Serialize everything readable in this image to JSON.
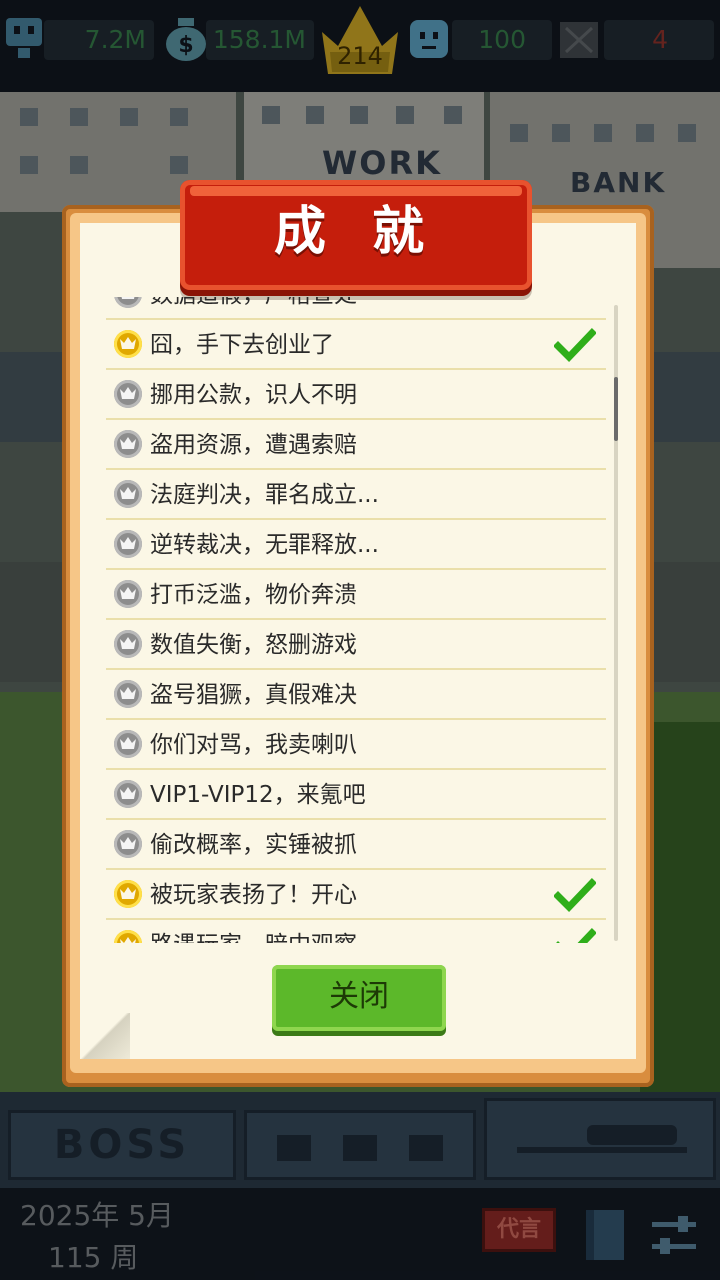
{
  "stats": {
    "employees": "7.2M",
    "money": "158.1M",
    "level": "214",
    "players": "100",
    "crossed": "4"
  },
  "background": {
    "sign_work": "WORK",
    "sign_bank": "BANK",
    "boss_tab": "BOSS"
  },
  "dialog": {
    "title": "成 就",
    "close_label": "关闭",
    "items": [
      {
        "label": "数据造假，严格查处",
        "achieved": false
      },
      {
        "label": "囧，手下去创业了",
        "achieved": true
      },
      {
        "label": "挪用公款，识人不明",
        "achieved": false
      },
      {
        "label": "盗用资源，遭遇索赔",
        "achieved": false
      },
      {
        "label": "法庭判决，罪名成立...",
        "achieved": false
      },
      {
        "label": "逆转裁决，无罪释放...",
        "achieved": false
      },
      {
        "label": "打币泛滥，物价奔溃",
        "achieved": false
      },
      {
        "label": "数值失衡，怒删游戏",
        "achieved": false
      },
      {
        "label": "盗号猖獗，真假难决",
        "achieved": false
      },
      {
        "label": "你们对骂，我卖喇叭",
        "achieved": false
      },
      {
        "label": "VIP1-VIP12，来氪吧",
        "achieved": false
      },
      {
        "label": "偷改概率，实锤被抓",
        "achieved": false
      },
      {
        "label": "被玩家表扬了！开心",
        "achieved": true
      },
      {
        "label": "路遇玩家，暗中观察",
        "achieved": true
      }
    ]
  },
  "footer": {
    "date": "2025年 5月",
    "week": "115 周",
    "agent_label": "代言"
  }
}
